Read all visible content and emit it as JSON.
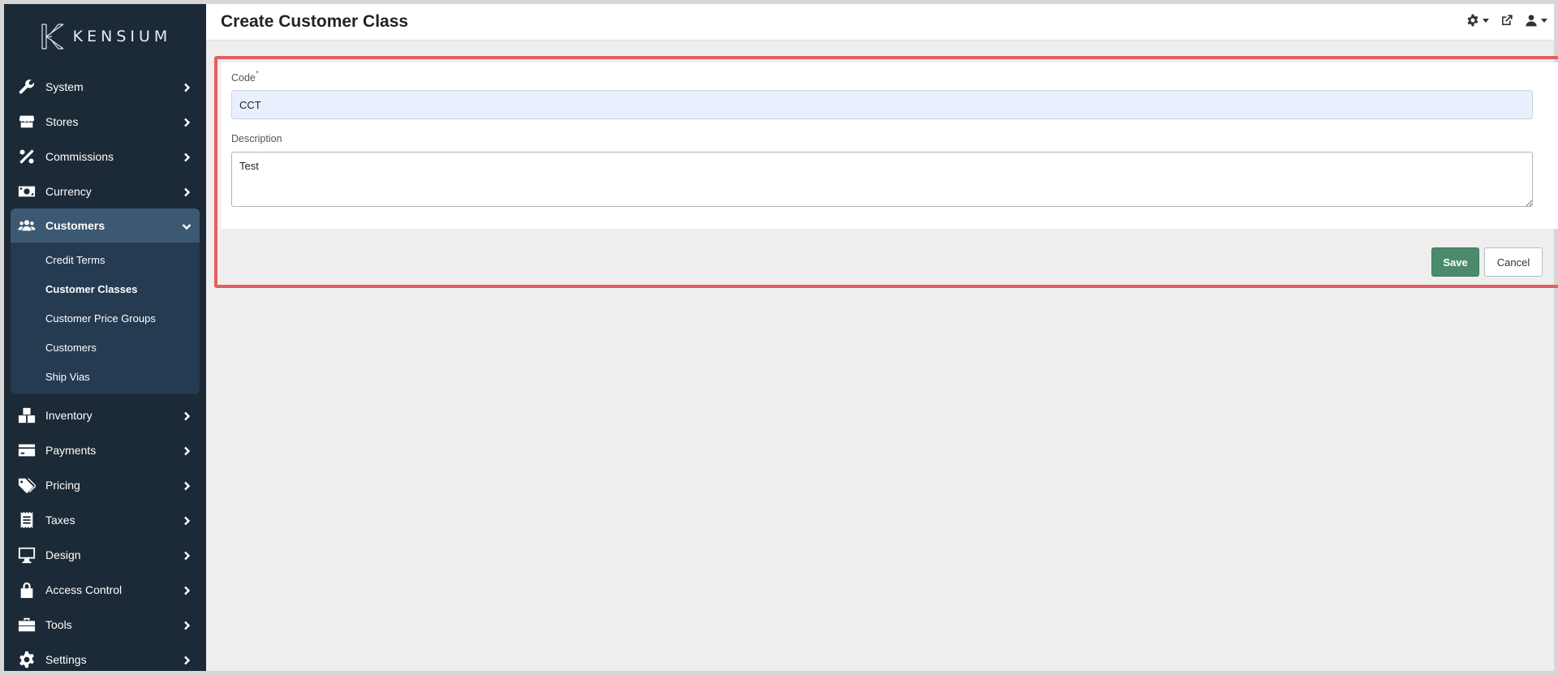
{
  "brand": {
    "name": "KENSIUM"
  },
  "sidebar": {
    "items": [
      {
        "label": "System",
        "icon": "wrench-icon"
      },
      {
        "label": "Stores",
        "icon": "store-icon"
      },
      {
        "label": "Commissions",
        "icon": "percent-icon"
      },
      {
        "label": "Currency",
        "icon": "money-icon"
      },
      {
        "label": "Customers",
        "icon": "users-icon",
        "expanded": true
      },
      {
        "label": "Inventory",
        "icon": "boxes-icon"
      },
      {
        "label": "Payments",
        "icon": "credit-card-icon"
      },
      {
        "label": "Pricing",
        "icon": "tags-icon"
      },
      {
        "label": "Taxes",
        "icon": "receipt-icon"
      },
      {
        "label": "Design",
        "icon": "desktop-icon"
      },
      {
        "label": "Access Control",
        "icon": "lock-icon"
      },
      {
        "label": "Tools",
        "icon": "toolbox-icon"
      },
      {
        "label": "Settings",
        "icon": "gear-icon"
      }
    ],
    "customers_sub": [
      {
        "label": "Credit Terms"
      },
      {
        "label": "Customer Classes",
        "current": true
      },
      {
        "label": "Customer Price Groups"
      },
      {
        "label": "Customers"
      },
      {
        "label": "Ship Vias"
      }
    ]
  },
  "header": {
    "title": "Create Customer Class"
  },
  "form": {
    "code_label": "Code",
    "required_mark": "*",
    "code_value": "CCT",
    "description_label": "Description",
    "description_value": "Test"
  },
  "actions": {
    "save_label": "Save",
    "cancel_label": "Cancel"
  },
  "colors": {
    "sidebar_bg": "#1c2936",
    "active_bg": "#3d5873",
    "save_bg": "#4b8b6b",
    "highlight": "#e35d60"
  }
}
